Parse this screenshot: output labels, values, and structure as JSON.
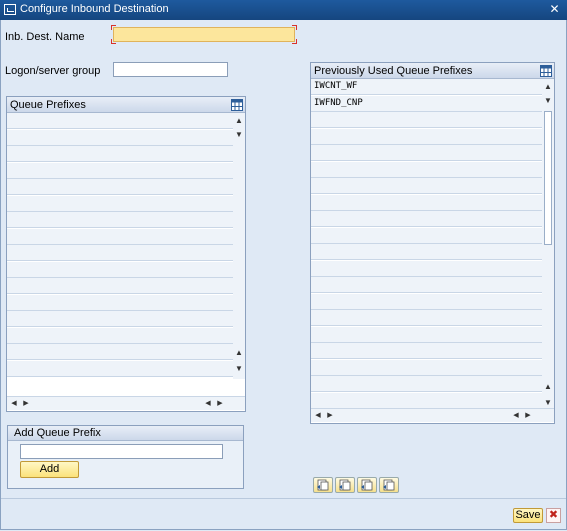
{
  "window": {
    "title": "Configure Inbound Destination",
    "close_glyph": "✕"
  },
  "form": {
    "inb_dest_label": "Inb. Dest. Name",
    "inb_dest_value": "",
    "logon_label": "Logon/server group",
    "logon_value": ""
  },
  "queue_prefixes": {
    "header": "Queue Prefixes",
    "rows": [
      "",
      "",
      "",
      "",
      "",
      "",
      "",
      "",
      "",
      "",
      "",
      "",
      "",
      "",
      "",
      ""
    ]
  },
  "previous_prefixes": {
    "header": "Previously Used Queue Prefixes",
    "rows": [
      "IWCNT_WF",
      "IWFND_CNP",
      "",
      "",
      "",
      "",
      "",
      "",
      "",
      "",
      "",
      "",
      "",
      "",
      "",
      "",
      "",
      "",
      "",
      ""
    ]
  },
  "add_queue": {
    "title": "Add Queue Prefix",
    "input_value": "",
    "add_label": "Add"
  },
  "footer": {
    "save_label": "Save",
    "cancel_glyph": "✖"
  },
  "icons": [
    "window-icon",
    "close-icon",
    "grid-settings-icon",
    "scroll-up-icon",
    "scroll-down-icon",
    "scroll-left-icon",
    "scroll-right-icon",
    "toolbar-icon",
    "cancel-icon"
  ],
  "colors": {
    "title_bar": "#1e5a9e",
    "background": "#dfe9f5",
    "required_field": "#fce69c",
    "button": "#fbe27b",
    "cancel": "#d9322a"
  }
}
